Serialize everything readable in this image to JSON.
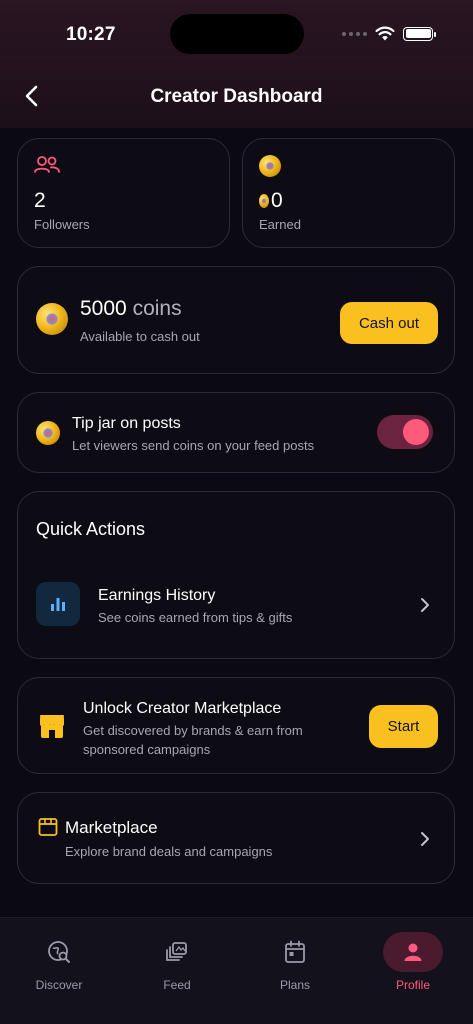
{
  "status_bar": {
    "time": "10:27"
  },
  "header": {
    "title": "Creator Dashboard",
    "back_icon": "chevron-left-icon"
  },
  "stats": {
    "followers": {
      "value": "2",
      "label": "Followers",
      "icon": "users-icon"
    },
    "earned": {
      "value": "0",
      "label": "Earned",
      "icon": "coin-icon"
    }
  },
  "balance": {
    "amount": "5000",
    "unit": "coins",
    "subtitle": "Available to cash out",
    "button_label": "Cash out"
  },
  "tip_jar": {
    "title": "Tip jar on posts",
    "subtitle": "Let viewers send coins on your feed posts",
    "enabled": true
  },
  "quick_actions": {
    "title": "Quick Actions",
    "items": [
      {
        "title": "Earnings History",
        "subtitle": "See coins earned from tips & gifts",
        "icon": "bar-chart-icon"
      }
    ]
  },
  "unlock_marketplace": {
    "title": "Unlock Creator Marketplace",
    "subtitle_line1": "Get discovered by brands & earn from",
    "subtitle_line2": "sponsored campaigns",
    "button_label": "Start",
    "icon": "store-icon"
  },
  "marketplace": {
    "title": "Marketplace",
    "subtitle": "Explore brand deals and campaigns",
    "icon": "store-icon"
  },
  "tabs": [
    {
      "label": "Discover",
      "icon": "discover-icon",
      "active": false
    },
    {
      "label": "Feed",
      "icon": "feed-icon",
      "active": false
    },
    {
      "label": "Plans",
      "icon": "calendar-icon",
      "active": false
    },
    {
      "label": "Profile",
      "icon": "person-icon",
      "active": true
    }
  ],
  "colors": {
    "accent_pink": "#ff5a7e",
    "accent_yellow": "#f9c01f",
    "background": "#0b0a14",
    "card_border": "#2c2a36"
  }
}
